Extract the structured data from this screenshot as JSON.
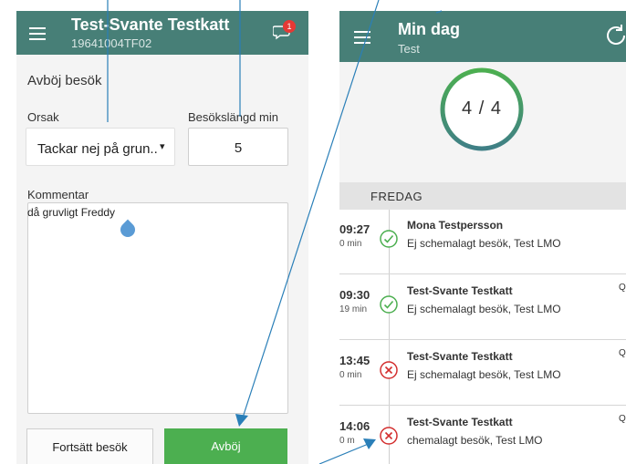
{
  "left_screen": {
    "title": "Test-Svante Testkatt",
    "subtitle": "19641004TF02",
    "chat_count": "1",
    "heading": "Avböj besök",
    "reason_label": "Orsak",
    "reason_value": "Tackar nej på grun..",
    "reason_caret": "▾",
    "length_label": "Besökslängd min",
    "length_value": "5",
    "comment_label": "Kommentar",
    "comment_value": "då gruvligt Freddy",
    "continue_button": "Fortsätt besök",
    "reject_button": "Avböj"
  },
  "right_screen": {
    "title": "Min dag",
    "subtitle": "Test",
    "progress_text": "4 / 4",
    "progress_fraction": 1.0,
    "day_label": "FREDAG",
    "visits": [
      {
        "time": "09:27",
        "duration": "0 min",
        "status": "check-circle-icon",
        "name": "Mona Testpersson",
        "desc": "Ej schemalagt besök, Test LMO",
        "search": ""
      },
      {
        "time": "09:30",
        "duration": "19 min",
        "status": "check-circle-icon",
        "name": "Test-Svante Testkatt",
        "desc": "Ej schemalagt besök, Test LMO",
        "search": "Q"
      },
      {
        "time": "13:45",
        "duration": "0 min",
        "status": "x-circle-icon",
        "name": "Test-Svante Testkatt",
        "desc": "Ej schemalagt besök, Test LMO",
        "search": "Q"
      },
      {
        "time": "14:06",
        "duration": "0 m",
        "status": "x-circle-icon",
        "name": "Test-Svante Testkatt",
        "desc": "chemalagt besök, Test LMO",
        "search": "Q"
      }
    ]
  },
  "colors": {
    "app_bar": "#477f77",
    "accept": "#4caf50",
    "reject": "#d32f2f",
    "badge": "#e53935",
    "pointer": "#2a7fb8"
  }
}
